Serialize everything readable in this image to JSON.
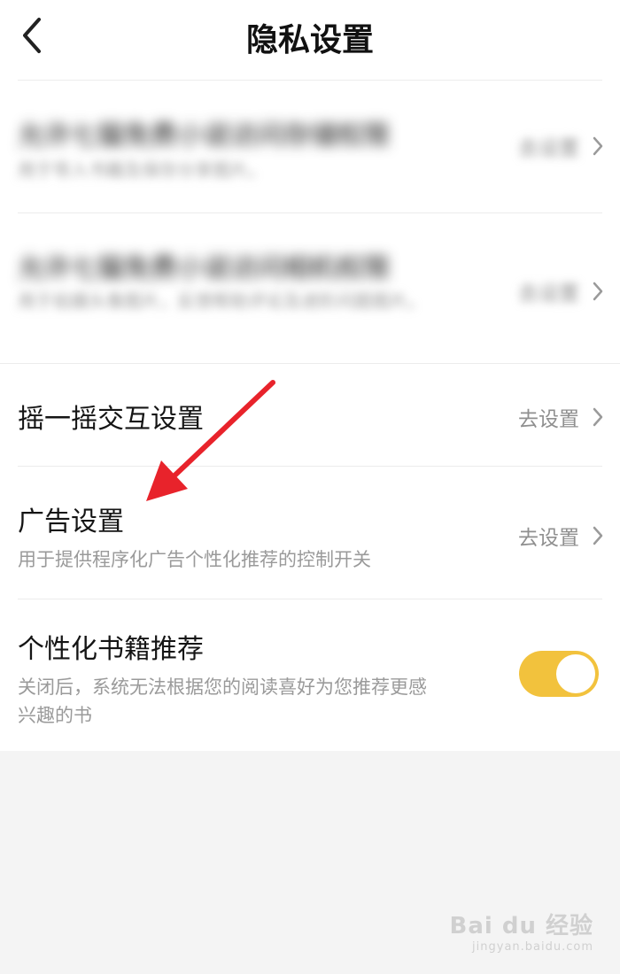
{
  "header": {
    "title": "隐私设置",
    "back_icon": "chevron-left-icon"
  },
  "items": [
    {
      "title": "允许七猫免费小说访问存储权限",
      "desc": "用于导入书籍及保存分享图片。",
      "action_label": "去设置"
    },
    {
      "title": "允许七猫免费小说访问相机权限",
      "desc": "用于拍摄头像图片，反馈帮助评论及进阶问题图片。",
      "action_label": "去设置"
    },
    {
      "title": "摇一摇交互设置",
      "action_label": "去设置"
    },
    {
      "title": "广告设置",
      "desc": "用于提供程序化广告个性化推荐的控制开关",
      "action_label": "去设置"
    },
    {
      "title": "个性化书籍推荐",
      "desc_line1": "关闭后，系统无法根据您的阅读喜好为您推荐更感",
      "desc_line2": "兴趣的书",
      "toggle_state": "on"
    }
  ],
  "colors": {
    "toggle_on": "#f2c23d",
    "annotation_arrow": "#e8232b",
    "background": "#f4f4f4"
  },
  "watermark": {
    "main": "Bai du 经验",
    "sub": "jingyan.baidu.com"
  }
}
